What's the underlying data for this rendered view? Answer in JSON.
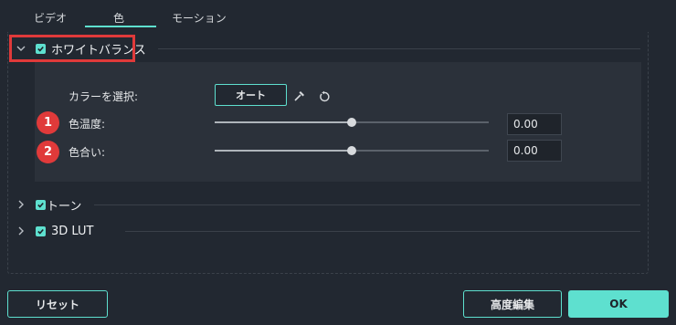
{
  "tabs": [
    {
      "label": "ビデオ"
    },
    {
      "label": "色"
    },
    {
      "label": "モーション"
    }
  ],
  "sections": {
    "white_balance": {
      "label": "ホワイトバランス",
      "expanded": true,
      "checked": true,
      "color_select_label": "カラーを選択:",
      "auto_button": "オート",
      "temperature": {
        "label": "色温度:",
        "value": "0.00",
        "level": 0.5
      },
      "tint": {
        "label": "色合い:",
        "value": "0.00",
        "level": 0.5
      }
    },
    "tone": {
      "label": "トーン",
      "checked": true,
      "expanded": false
    },
    "lut": {
      "label": "3D LUT",
      "checked": true,
      "expanded": false
    }
  },
  "badges": [
    "1",
    "2"
  ],
  "footer": {
    "reset_button": "リセット",
    "advanced_button": "高度編集",
    "ok_button": "OK"
  },
  "colors": {
    "accent": "#5ee0cf",
    "highlight": "#e03a3a",
    "background": "#222831"
  }
}
